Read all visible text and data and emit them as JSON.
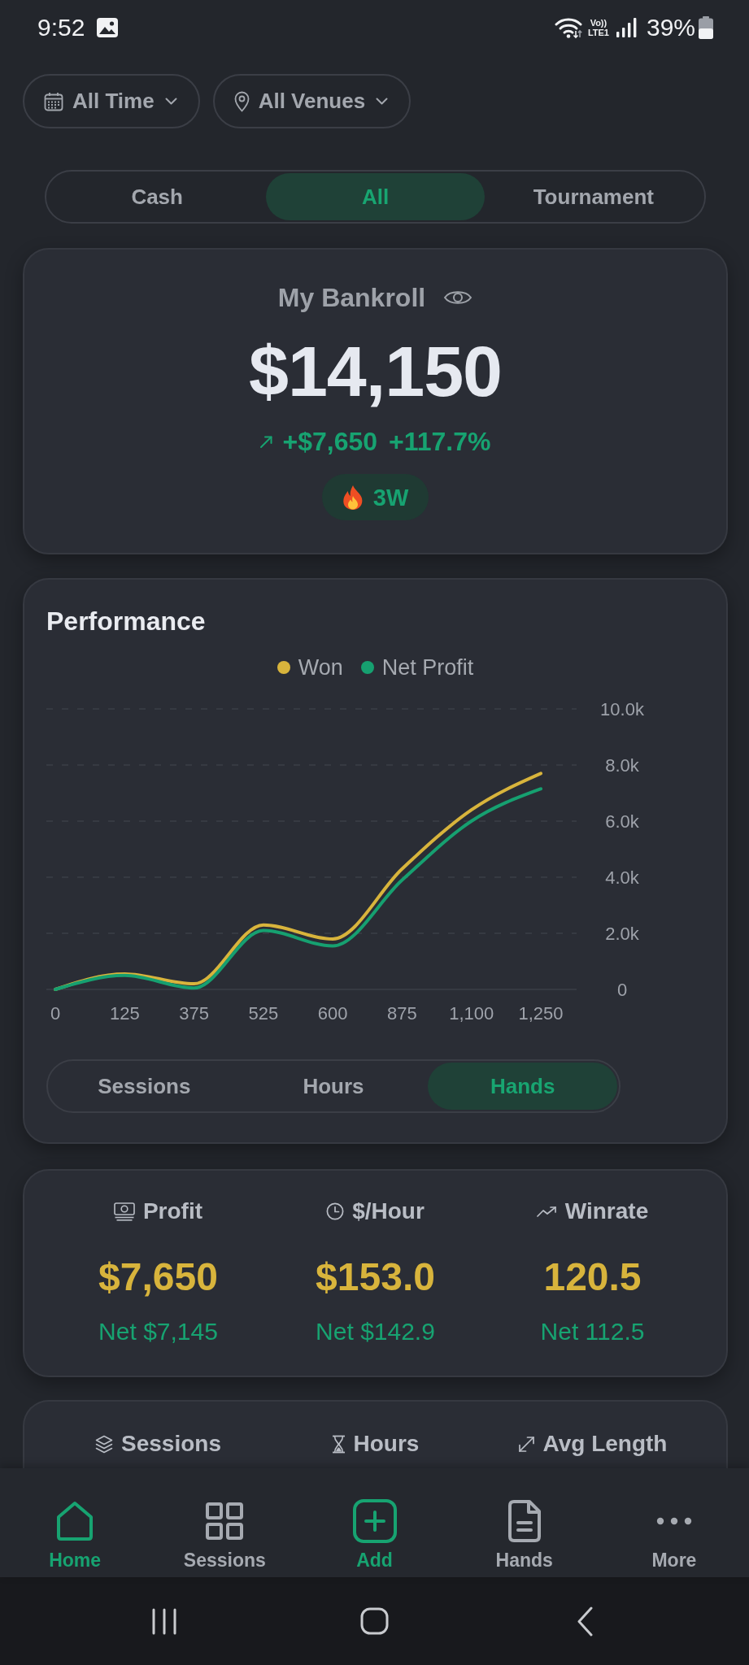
{
  "status_bar": {
    "time": "9:52",
    "volte": "Vo))",
    "network": "LTE1",
    "battery": "39%"
  },
  "filters": [
    {
      "kind": "date",
      "label": "All Time"
    },
    {
      "kind": "venue",
      "label": "All Venues"
    }
  ],
  "game_tabs": [
    {
      "label": "Cash",
      "selected": false
    },
    {
      "label": "All",
      "selected": true
    },
    {
      "label": "Tournament",
      "selected": false
    }
  ],
  "bankroll": {
    "title": "My Bankroll",
    "amount": "$14,150",
    "change": "+$7,650",
    "change_percent": "+117.7%",
    "streak": "3W"
  },
  "performance": {
    "title": "Performance",
    "chart_data": {
      "type": "line",
      "legend": true,
      "grid": true,
      "categories": [
        "0",
        "125",
        "375",
        "525",
        "600",
        "875",
        "1,100",
        "1,250"
      ],
      "series": [
        {
          "name": "Won",
          "color": "#d8b43c",
          "values": [
            0,
            550,
            200,
            2300,
            1800,
            4300,
            6400,
            7700
          ]
        },
        {
          "name": "Net Profit",
          "color": "#16a070",
          "values": [
            0,
            500,
            50,
            2100,
            1550,
            3900,
            6000,
            7150
          ]
        }
      ],
      "ylim": [
        0,
        10000
      ],
      "yticks": [
        {
          "value": 0,
          "label": "0"
        },
        {
          "value": 2000,
          "label": "2.0k"
        },
        {
          "value": 4000,
          "label": "4.0k"
        },
        {
          "value": 6000,
          "label": "6.0k"
        },
        {
          "value": 8000,
          "label": "8.0k"
        },
        {
          "value": 10000,
          "label": "10.0k"
        }
      ]
    },
    "axis_tabs": [
      {
        "label": "Sessions",
        "selected": false
      },
      {
        "label": "Hours",
        "selected": false
      },
      {
        "label": "Hands",
        "selected": true
      }
    ]
  },
  "stats": [
    {
      "kind": "profit",
      "label": "Profit",
      "value": "$7,650",
      "net": "Net $7,145"
    },
    {
      "kind": "hourly",
      "label": "$/Hour",
      "value": "$153.0",
      "net": "Net $142.9"
    },
    {
      "kind": "winrate",
      "label": "Winrate",
      "value": "120.5",
      "net": "Net 112.5"
    }
  ],
  "stats_more": [
    {
      "kind": "sessions",
      "label": "Sessions"
    },
    {
      "kind": "hours",
      "label": "Hours"
    },
    {
      "kind": "avg_length",
      "label": "Avg Length"
    }
  ],
  "bottom_nav": [
    {
      "kind": "home",
      "label": "Home",
      "selected": true
    },
    {
      "kind": "sessions",
      "label": "Sessions",
      "selected": false
    },
    {
      "kind": "add",
      "label": "Add"
    },
    {
      "kind": "hands",
      "label": "Hands",
      "selected": false
    },
    {
      "kind": "more",
      "label": "More",
      "selected": false
    }
  ]
}
